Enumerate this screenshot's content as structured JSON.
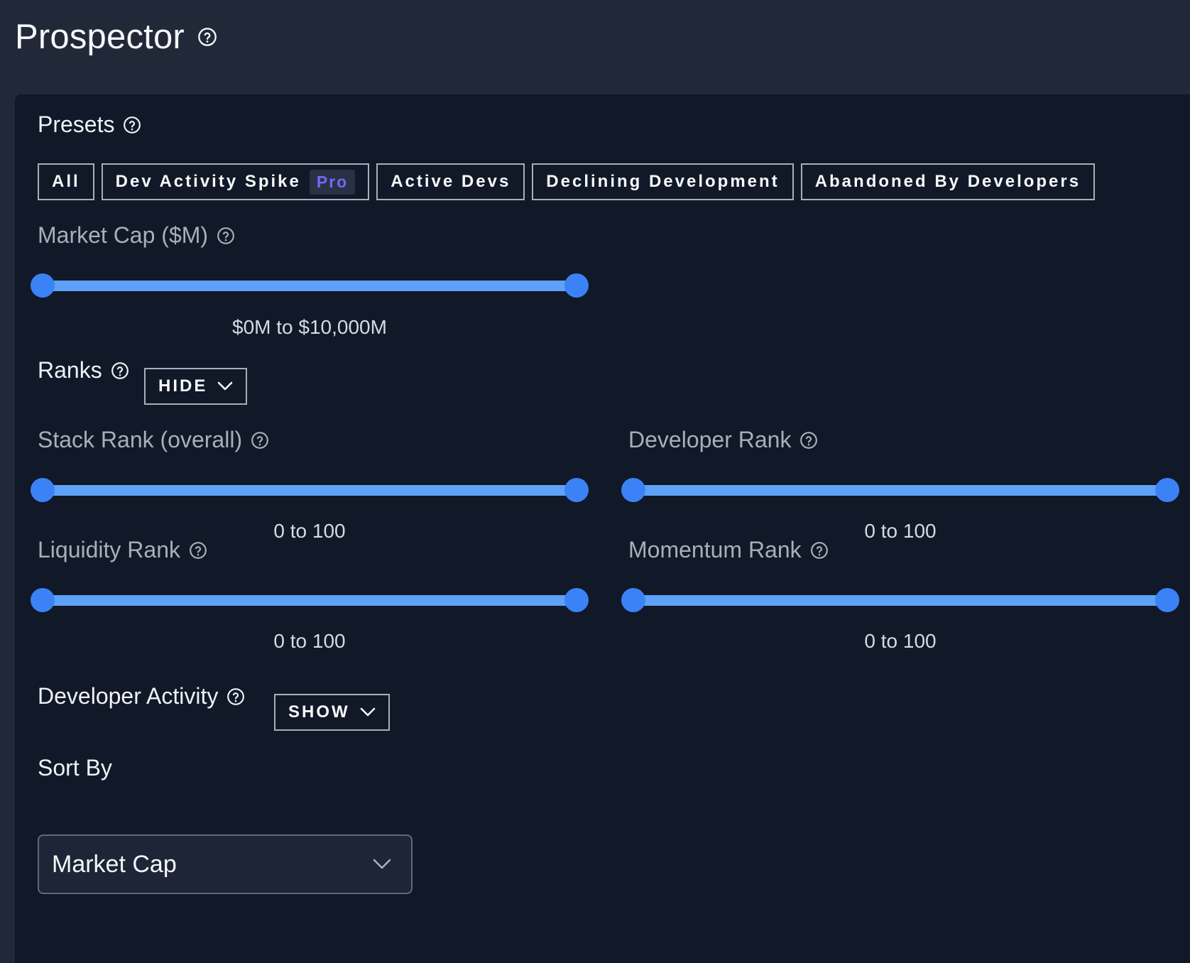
{
  "page": {
    "title": "Prospector",
    "title_icon": "help-circle-icon"
  },
  "presets": {
    "label": "Presets",
    "help_icon": "help-circle-icon",
    "items": [
      {
        "label": "All"
      },
      {
        "label": "Dev Activity Spike",
        "badge": "Pro"
      },
      {
        "label": "Active Devs"
      },
      {
        "label": "Declining Development"
      },
      {
        "label": "Abandoned By Developers"
      }
    ]
  },
  "market_cap": {
    "label": "Market Cap ($M)",
    "range_text": "$0M to $10,000M",
    "min": 0,
    "max": 10000,
    "selected_min": 0,
    "selected_max": 10000
  },
  "ranks": {
    "label": "Ranks",
    "toggle_label": "HIDE",
    "items": [
      {
        "label": "Stack Rank (overall)",
        "range_text": "0 to 100",
        "selected_min": 0,
        "selected_max": 100
      },
      {
        "label": "Developer Rank",
        "range_text": "0 to 100",
        "selected_min": 0,
        "selected_max": 100
      },
      {
        "label": "Liquidity Rank",
        "range_text": "0 to 100",
        "selected_min": 0,
        "selected_max": 100
      },
      {
        "label": "Momentum Rank",
        "range_text": "0 to 100",
        "selected_min": 0,
        "selected_max": 100
      }
    ]
  },
  "developer_activity": {
    "label": "Developer Activity",
    "toggle_label": "SHOW"
  },
  "sort": {
    "label": "Sort By",
    "selected": "Market Cap"
  },
  "colors": {
    "background": "#212938",
    "panel": "#111827",
    "accent": "#3b82f6",
    "track": "#5ea1f8",
    "pro_badge": "#6d6bff"
  }
}
